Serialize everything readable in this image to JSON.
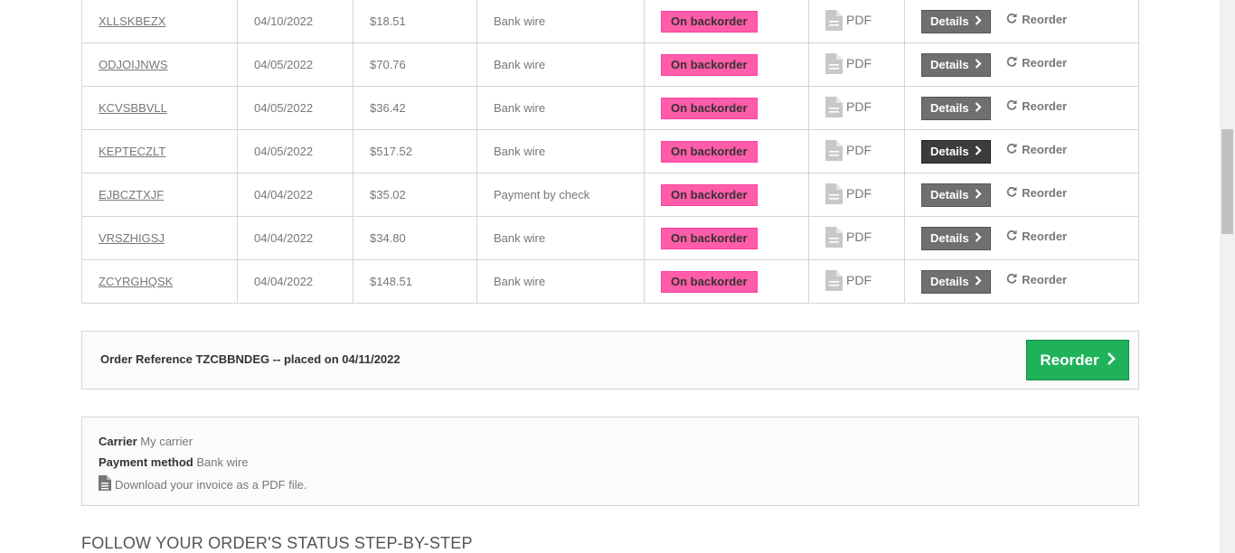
{
  "orders": [
    {
      "reference": "XLLSKBEZX",
      "date": "04/10/2022",
      "price": "$18.51",
      "payment": "Bank wire",
      "status": "On backorder",
      "invoice": "PDF",
      "details_label": "Details",
      "reorder_label": "Reorder"
    },
    {
      "reference": "ODJOIJNWS",
      "date": "04/05/2022",
      "price": "$70.76",
      "payment": "Bank wire",
      "status": "On backorder",
      "invoice": "PDF",
      "details_label": "Details",
      "reorder_label": "Reorder"
    },
    {
      "reference": "KCVSBBVLL",
      "date": "04/05/2022",
      "price": "$36.42",
      "payment": "Bank wire",
      "status": "On backorder",
      "invoice": "PDF",
      "details_label": "Details",
      "reorder_label": "Reorder"
    },
    {
      "reference": "KEPTECZLT",
      "date": "04/05/2022",
      "price": "$517.52",
      "payment": "Bank wire",
      "status": "On backorder",
      "invoice": "PDF",
      "details_label": "Details",
      "reorder_label": "Reorder"
    },
    {
      "reference": "EJBCZTXJF",
      "date": "04/04/2022",
      "price": "$35.02",
      "payment": "Payment by check",
      "status": "On backorder",
      "invoice": "PDF",
      "details_label": "Details",
      "reorder_label": "Reorder"
    },
    {
      "reference": "VRSZHIGSJ",
      "date": "04/04/2022",
      "price": "$34.80",
      "payment": "Bank wire",
      "status": "On backorder",
      "invoice": "PDF",
      "details_label": "Details",
      "reorder_label": "Reorder"
    },
    {
      "reference": "ZCYRGHQSK",
      "date": "04/04/2022",
      "price": "$148.51",
      "payment": "Bank wire",
      "status": "On backorder",
      "invoice": "PDF",
      "details_label": "Details",
      "reorder_label": "Reorder"
    }
  ],
  "order_detail": {
    "title": "Order Reference TZCBBNDEG -- placed on 04/11/2022",
    "reorder_label": "Reorder",
    "carrier_label": "Carrier",
    "carrier_value": "My carrier",
    "payment_label": "Payment method",
    "payment_value": "Bank wire",
    "invoice_text": "Download your invoice as a PDF file."
  },
  "status_section": {
    "heading": "FOLLOW YOUR ORDER'S STATUS STEP-BY-STEP"
  },
  "colors": {
    "status_badge": "#ff5ca9",
    "reorder_button": "#1fb25a",
    "details_button": "#6f6f6f"
  },
  "icons": {
    "invoice": "pdf-file-icon",
    "reorder": "refresh-icon",
    "details": "chevron-right-icon"
  }
}
